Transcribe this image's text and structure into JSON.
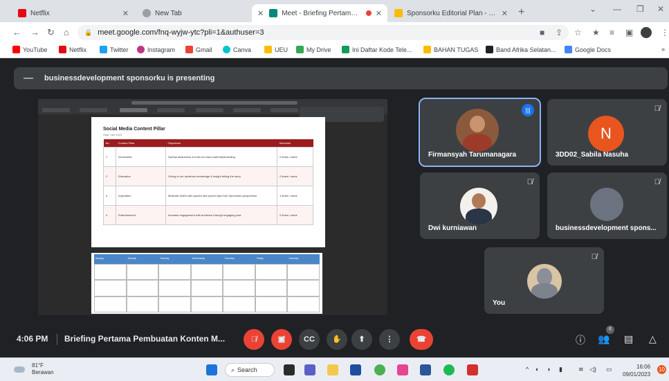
{
  "browser": {
    "tabs": [
      {
        "title": "Netflix",
        "color": "#e50914"
      },
      {
        "title": "New Tab",
        "color": "#5f6368"
      },
      {
        "title": "Meet - Briefing Pertama Pem",
        "color": "#00897b"
      },
      {
        "title": "Sponsorku Editorial Plan - Janua",
        "color": "#fbbc04"
      }
    ],
    "new_tab": "+",
    "url": "meet.google.com/fnq-wyjw-ytc?pli=1&authuser=3",
    "bookmarks": [
      {
        "label": "YouTube",
        "color": "#ff0000"
      },
      {
        "label": "Netflix",
        "color": "#e50914"
      },
      {
        "label": "Twitter",
        "color": "#1da1f2"
      },
      {
        "label": "Instagram",
        "color": "#c13584"
      },
      {
        "label": "Gmail",
        "color": "#ea4335"
      },
      {
        "label": "Canva",
        "color": "#00c4cc"
      },
      {
        "label": "UEU",
        "color": "#fbbc04"
      },
      {
        "label": "My Drive",
        "color": "#34a853"
      },
      {
        "label": "Ini Daftar Kode Tele...",
        "color": "#0f9d58"
      },
      {
        "label": "BAHAN TUGAS",
        "color": "#fbbc04"
      },
      {
        "label": "Band Afrika Selatan...",
        "color": "#202124"
      },
      {
        "label": "Google Docs",
        "color": "#4285f4"
      }
    ]
  },
  "meet": {
    "presenting": "businessdevelopment sponsorku is presenting",
    "shared_doc": {
      "title": "Social Media Content Pillar",
      "subtitle": "Start: Jan 2023",
      "headers": [
        "No.",
        "Content Pillar",
        "Objectives",
        "Schedule"
      ],
      "rows": [
        [
          "1",
          "Informative",
          "Spread awareness & build on brand authority/branding.",
          "2 times / week"
        ],
        [
          "2",
          "Education",
          "Giving to our audience knowledge & insight telling the story.",
          "2 times / week"
        ],
        [
          "3",
          "Inspiration",
          "Motivate others with quotes and proven tips from Sponsorku perspective.",
          "1 times / week"
        ],
        [
          "4",
          "Entertainment",
          "Increase engagement with audience through engaging post.",
          "2 times / week"
        ]
      ],
      "calendar_days": [
        "Sunday",
        "Monday",
        "Tuesday",
        "Wednesday",
        "Thursday",
        "Friday",
        "Saturday"
      ]
    },
    "participants": [
      {
        "name": "Firmansyah Tarumanagara",
        "speaking": true
      },
      {
        "name": "3DD02_Sabila Nasuha",
        "initial": "N"
      },
      {
        "name": "Dwi kurniawan"
      },
      {
        "name": "businessdevelopment spons..."
      },
      {
        "name": "You"
      }
    ],
    "time": "4:06 PM",
    "meeting_title": "Briefing Pertama Pembuatan Konten M...",
    "participant_count": "6"
  },
  "taskbar": {
    "temperature": "81°F",
    "weather": "Berawan",
    "search": "Search",
    "time": "16:06",
    "date": "09/01/2023",
    "notifications": "10"
  }
}
